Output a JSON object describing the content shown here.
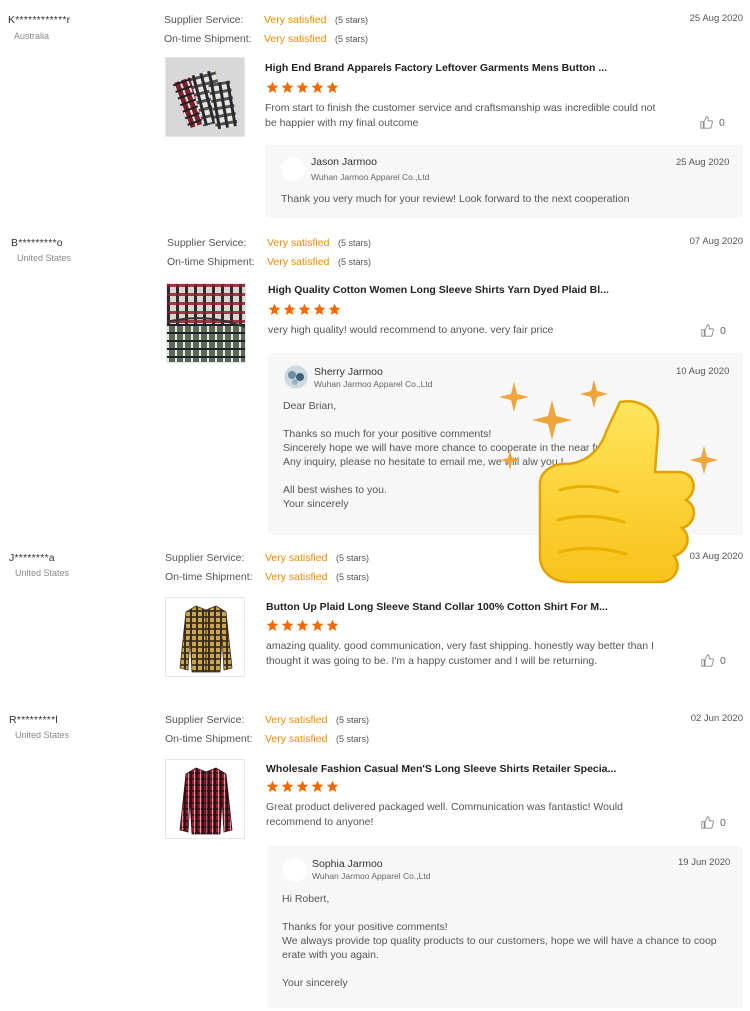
{
  "labels": {
    "supplier_service": "Supplier Service:",
    "ontime_shipment": "On-time Shipment:",
    "rating_value": "Very satisfied",
    "rating_stars": "(5 stars)"
  },
  "colors": {
    "accent": "#f08a00",
    "star": "#f56a00"
  },
  "reviews": [
    {
      "buyer": "K************r",
      "country": "Australia",
      "date": "25 Aug 2020",
      "product_title": "High End Brand Apparels Factory Leftover Garments Mens Button ...",
      "rating": 5,
      "text": "From start to finish the customer service and craftsmanship was incredible could not be happier with my final outcome",
      "likes": "0",
      "reply": {
        "name": "Jason Jarmoo",
        "company": "Wuhan Jarmoo Apparel Co.,Ltd",
        "date": "25 Aug 2020",
        "text": "Thank you very much for your review! Look forward to the next cooperation"
      }
    },
    {
      "buyer": "B*********o",
      "country": "United States",
      "date": "07 Aug 2020",
      "product_title": "High Quality Cotton Women Long Sleeve Shirts Yarn Dyed Plaid Bl...",
      "rating": 5,
      "text": "very high quality! would recommend to anyone. very fair price",
      "likes": "0",
      "reply": {
        "name": "Sherry Jarmoo",
        "company": "Wuhan Jarmoo Apparel Co.,Ltd",
        "date": "10 Aug 2020",
        "text": "Dear Brian,\n\nThanks so much for your positive comments!\nSincerely hope we will have more chance to cooperate in the near futur\nAny inquiry, please no hesitate to email me, we will alw                                you !\n\nAll best wishes to you.\nYour sincerely"
      }
    },
    {
      "buyer": "J********a",
      "country": "United States",
      "date": "03 Aug 2020",
      "product_title": "Button Up Plaid Long Sleeve Stand Collar 100% Cotton Shirt For M...",
      "rating": 5,
      "text": "amazing quality. good communication, very fast shipping.  honestly way better than I thought it was going to be. I'm a happy customer and I will be returning.",
      "likes": "0"
    },
    {
      "buyer": "R*********l",
      "country": "United States",
      "date": "02 Jun 2020",
      "product_title": "Wholesale Fashion Casual Men'S Long Sleeve Shirts Retailer Specia...",
      "rating": 5,
      "text": "Great product delivered packaged well.  Communication was fantastic!  Would recommend to anyone!",
      "likes": "0",
      "reply": {
        "name": "Sophia Jarmoo",
        "company": "Wuhan Jarmoo Apparel Co.,Ltd",
        "date": "19 Jun 2020",
        "text": "Hi Robert,\n\nThanks for your positive comments!\nWe always provide top quality products to our customers, hope we will have a chance to coop\nerate with you again.\n\nYour sincerely"
      }
    }
  ]
}
